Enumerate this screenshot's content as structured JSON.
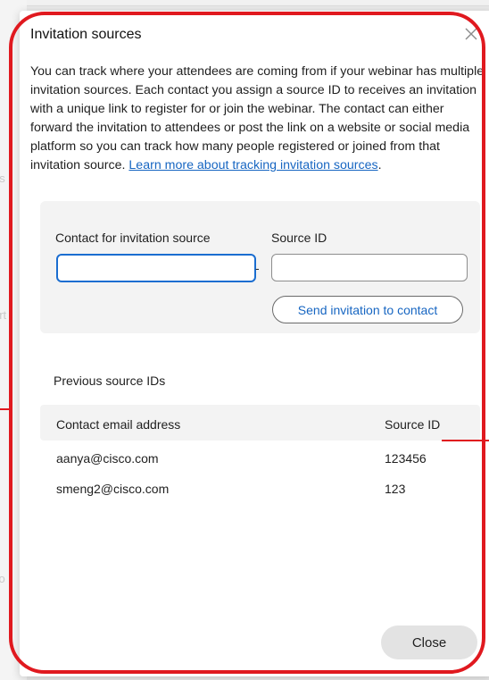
{
  "background": {
    "faded_labels": [
      "es",
      "ort",
      "co"
    ]
  },
  "dialog": {
    "title": "Invitation sources",
    "close_icon": "close-icon",
    "description_text": "You can track where your attendees are coming from if your webinar has multiple invitation sources. Each contact you assign a source ID to receives an invitation with a unique link to register for or join the webinar. The contact can either forward the invitation to attendees or post the link on a website or social media platform so you can track how many people registered or joined from that invitation source.",
    "learn_more_link": "Learn more about tracking invitation sources",
    "learn_more_suffix": "."
  },
  "form": {
    "contact_label": "Contact for invitation source",
    "contact_value": "",
    "separator": "-",
    "source_id_label": "Source ID",
    "source_id_value": "",
    "send_button": "Send invitation to contact"
  },
  "previous": {
    "title": "Previous source IDs",
    "columns": [
      "Contact email address",
      "Source ID"
    ],
    "rows": [
      {
        "email": "aanya@cisco.com",
        "source_id": "123456"
      },
      {
        "email": "smeng2@cisco.com",
        "source_id": "123"
      }
    ]
  },
  "footer": {
    "close_button": "Close"
  },
  "colors": {
    "annotation": "#e0191f",
    "link": "#1766c2",
    "focus_border": "#1a6dd0",
    "panel_bg": "#f3f3f3"
  }
}
